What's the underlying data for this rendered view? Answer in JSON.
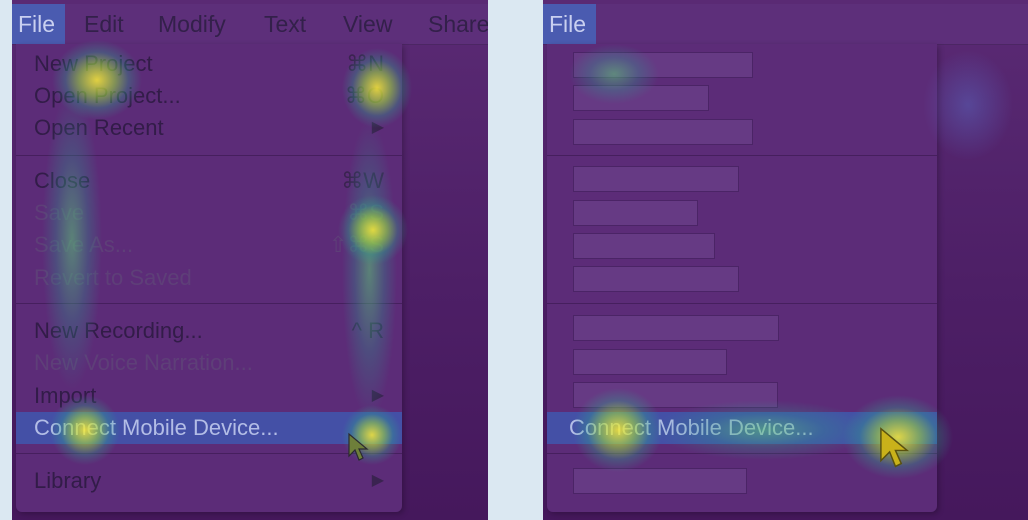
{
  "left": {
    "menubar": {
      "file": "File",
      "items": [
        "Edit",
        "Modify",
        "Text",
        "View",
        "Share"
      ]
    },
    "menu": {
      "new_project": {
        "label": "New Project",
        "shortcut": "⌘N"
      },
      "open_project": {
        "label": "Open Project...",
        "shortcut": "⌘O"
      },
      "open_recent": {
        "label": "Open Recent",
        "shortcut": "▶"
      },
      "close": {
        "label": "Close",
        "shortcut": "⌘W"
      },
      "save": {
        "label": "Save",
        "shortcut": "⌘S"
      },
      "save_as": {
        "label": "Save As...",
        "shortcut": "⇧⌘S"
      },
      "revert": {
        "label": "Revert to Saved",
        "shortcut": ""
      },
      "new_recording": {
        "label": "New Recording...",
        "shortcut": "^ R"
      },
      "new_voice": {
        "label": "New Voice Narration...",
        "shortcut": ""
      },
      "import": {
        "label": "Import",
        "shortcut": "▶"
      },
      "connect": {
        "label": "Connect Mobile Device...",
        "shortcut": ""
      },
      "library": {
        "label": "Library",
        "shortcut": "▶"
      }
    }
  },
  "right": {
    "menubar": {
      "file": "File"
    },
    "menu": {
      "connect": {
        "label": "Connect Mobile Device..."
      }
    }
  },
  "colors": {
    "background": "#dbe8f2",
    "menu_purple": "#5c2c78",
    "highlight": "#4450a6",
    "heat_yellow": "#f8ec38"
  },
  "icons": {
    "cursor": "arrow-pointer-icon"
  }
}
